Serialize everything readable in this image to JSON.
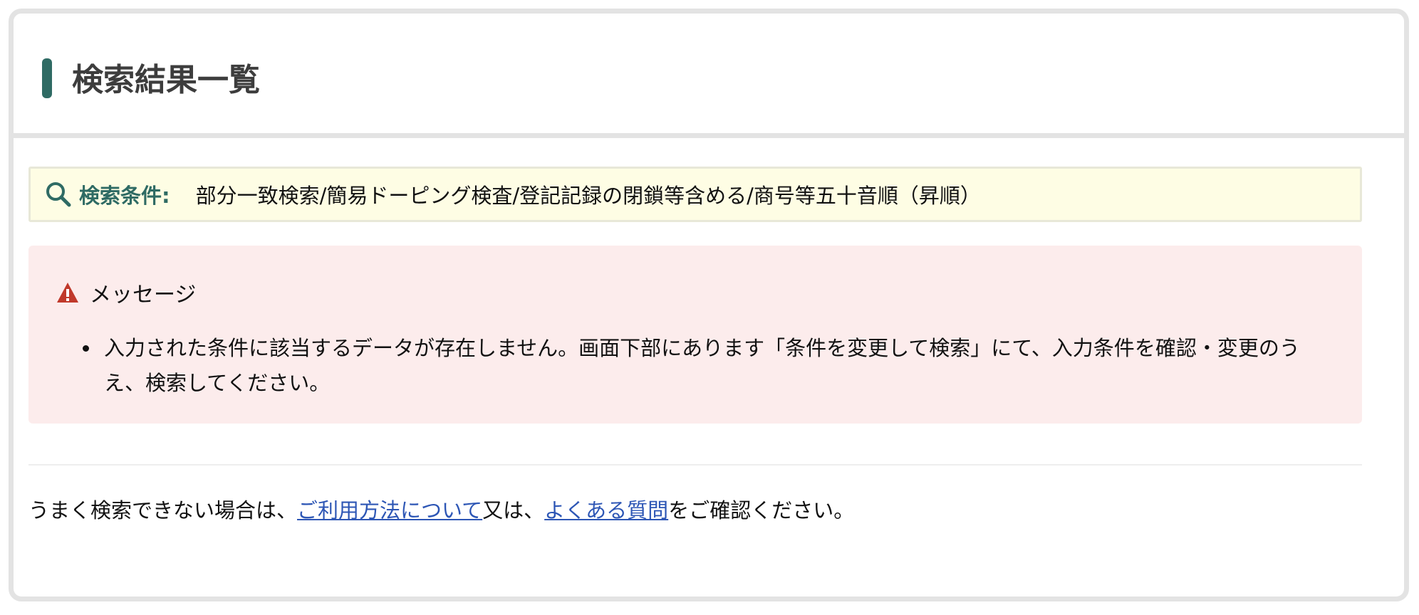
{
  "header": {
    "title": "検索結果一覧"
  },
  "condition": {
    "label": "検索条件:",
    "value": "部分一致検索/簡易ドーピング検査/登記記録の閉鎖等含める/商号等五十音順（昇順）"
  },
  "message": {
    "title": "メッセージ",
    "items": [
      "入力された条件に該当するデータが存在しません。画面下部にあります「条件を変更して検索」にて、入力条件を確認・変更のうえ、検索してください。"
    ]
  },
  "help": {
    "prefix": "うまく検索できない場合は、",
    "usage_link": "ご利用方法について",
    "middle": "又は、",
    "faq_link": "よくある質問",
    "suffix": "をご確認ください。"
  },
  "colors": {
    "accent": "#2f6b64",
    "condition_bg": "#fefde4",
    "message_bg": "#fcecec",
    "warning": "#c0392b",
    "link": "#2d56b5"
  },
  "icons": {
    "condition": "search-icon",
    "message": "warning-icon"
  }
}
